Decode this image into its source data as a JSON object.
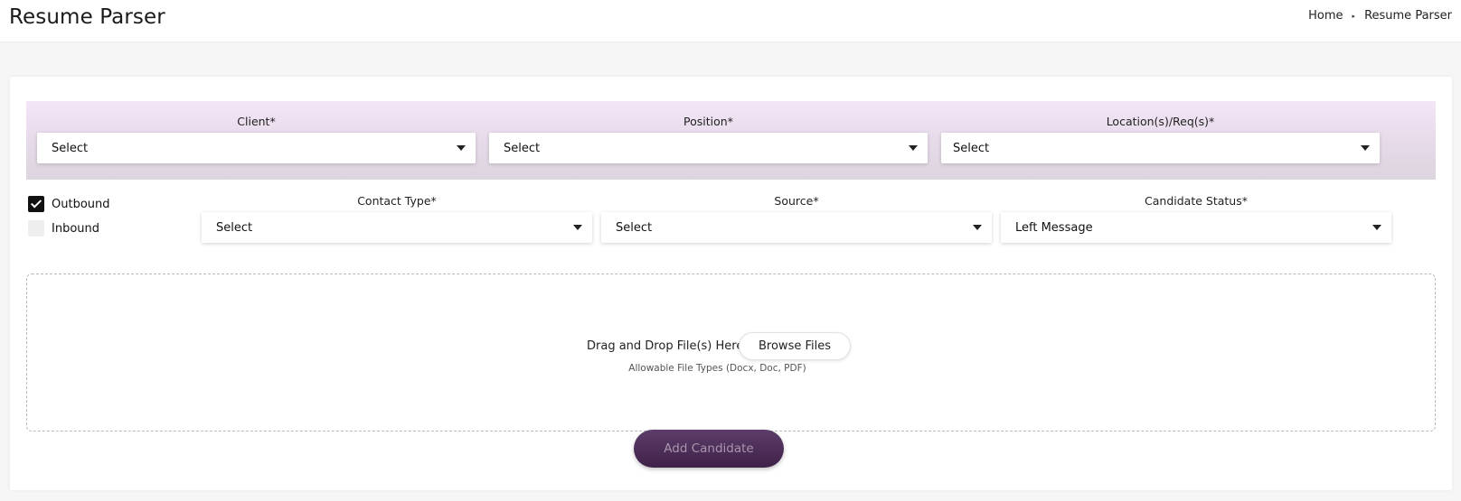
{
  "header": {
    "title": "Resume Parser",
    "breadcrumb": {
      "home": "Home",
      "separator": "▸",
      "current": "Resume Parser"
    }
  },
  "filters": {
    "client": {
      "label": "Client*",
      "value": "Select"
    },
    "position": {
      "label": "Position*",
      "value": "Select"
    },
    "location": {
      "label": "Location(s)/Req(s)*",
      "value": "Select"
    }
  },
  "direction": {
    "outbound": {
      "label": "Outbound",
      "checked": true
    },
    "inbound": {
      "label": "Inbound",
      "checked": false
    }
  },
  "details": {
    "contact_type": {
      "label": "Contact Type*",
      "value": "Select"
    },
    "source": {
      "label": "Source*",
      "value": "Select"
    },
    "candidate_status": {
      "label": "Candidate Status*",
      "value": "Left Message"
    }
  },
  "upload": {
    "prompt": "Drag and Drop File(s) Here or",
    "browse_label": "Browse Files",
    "allowed_types": "Allowable File Types (Docx, Doc, PDF)"
  },
  "actions": {
    "add_candidate": "Add Candidate"
  },
  "colors": {
    "band_top": "#f3e6f7",
    "band_bottom": "#dcd4de",
    "button_primary": "#4e2f5a"
  }
}
